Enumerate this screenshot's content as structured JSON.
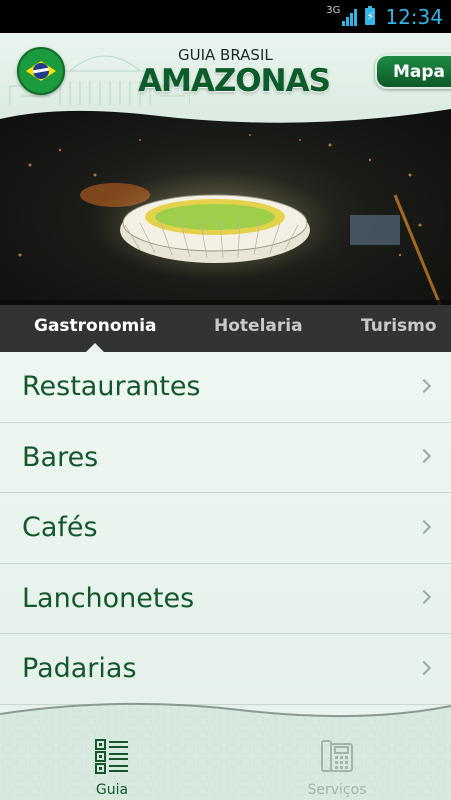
{
  "status_bar": {
    "network": "3G",
    "time": "12:34"
  },
  "header": {
    "logo_top": "GUIA BRASIL",
    "logo_main": "AMAZONAS",
    "map_button": "Mapa"
  },
  "tabs": [
    {
      "label": "Gastronomia",
      "active": true
    },
    {
      "label": "Hotelaria",
      "active": false
    },
    {
      "label": "Turismo",
      "active": false
    }
  ],
  "list": {
    "items": [
      {
        "label": "Restaurantes"
      },
      {
        "label": "Bares"
      },
      {
        "label": "Cafés"
      },
      {
        "label": "Lanchonetes"
      },
      {
        "label": "Padarias"
      }
    ]
  },
  "bottom_nav": {
    "items": [
      {
        "label": "Guia",
        "icon": "guide-list-icon",
        "active": true
      },
      {
        "label": "Serviços",
        "icon": "telephone-icon",
        "active": false
      }
    ]
  },
  "colors": {
    "brand_green": "#14572c",
    "accent_green": "#1f8a45",
    "status_blue": "#33b5e5"
  }
}
